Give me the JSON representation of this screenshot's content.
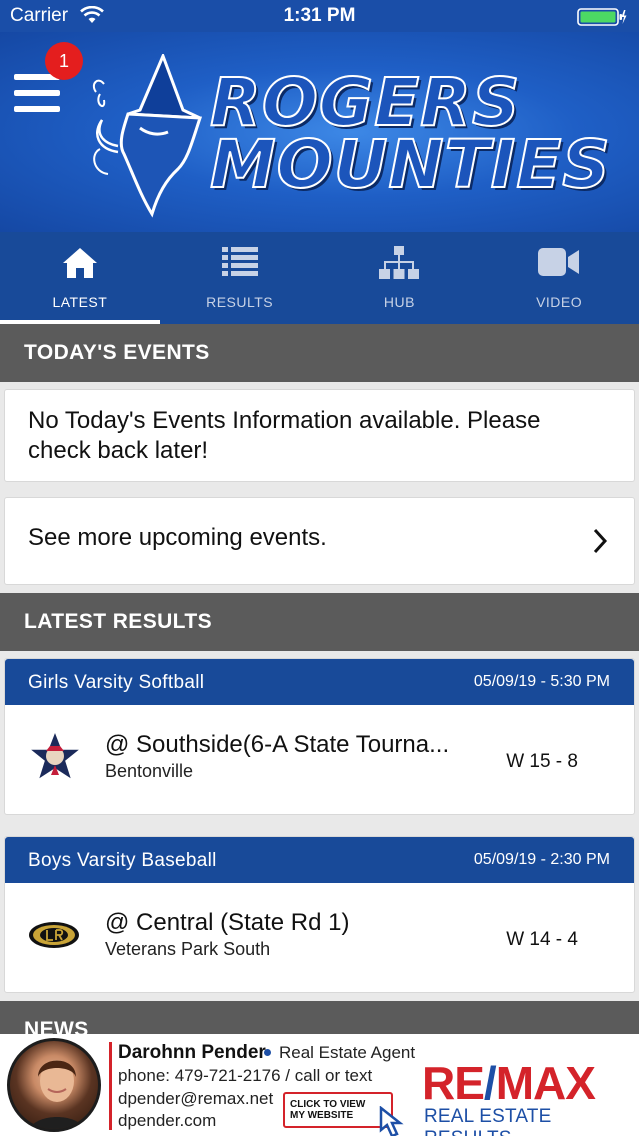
{
  "status_bar": {
    "carrier": "Carrier",
    "time": "1:31 PM"
  },
  "header": {
    "notification_count": "1",
    "team_name_line1": "ROGERS",
    "team_name_line2": "MOUNTIES"
  },
  "tabs": [
    {
      "label": "LATEST",
      "icon": "home-icon",
      "active": true
    },
    {
      "label": "RESULTS",
      "icon": "list-icon",
      "active": false
    },
    {
      "label": "HUB",
      "icon": "hub-icon",
      "active": false
    },
    {
      "label": "VIDEO",
      "icon": "video-camera-icon",
      "active": false
    }
  ],
  "todays_events": {
    "title": "TODAY'S EVENTS",
    "message": "No Today's Events Information available. Please check back later!",
    "more_link": "See more upcoming events."
  },
  "latest_results": {
    "title": "LATEST RESULTS",
    "items": [
      {
        "sport": "Girls Varsity Softball",
        "datetime": "05/09/19 - 5:30 PM",
        "opponent": "@ Southside(6-A State Tourna...",
        "venue": "Bentonville",
        "score": "W 15 - 8",
        "logo_icon": "southside-star-logo-icon"
      },
      {
        "sport": "Boys Varsity Baseball",
        "datetime": "05/09/19 - 2:30 PM",
        "opponent": "@ Central (State Rd 1)",
        "venue": "Veterans Park South",
        "score": "W 14 - 4",
        "logo_icon": "central-lr-logo-icon"
      }
    ]
  },
  "news": {
    "title": "NEWS"
  },
  "ad": {
    "name": "Darohnn Pender",
    "role": "Real Estate Agent",
    "phone": "phone: 479-721-2176 / call or text",
    "email": "dpender@remax.net",
    "website": "dpender.com",
    "cta_line1": "CLICK TO VIEW",
    "cta_line2": "MY WEBSITE",
    "brand_left": "RE",
    "brand_slash": "/",
    "brand_right": "MAX",
    "brand_sub": "REAL ESTATE RESULTS"
  },
  "colors": {
    "header_blue": "#1a4ea8",
    "tab_bar": "#184a99",
    "section_gray": "#5b5b5b",
    "badge_red": "#e41e1e",
    "remax_red": "#d4232a",
    "remax_blue": "#1d4fa6"
  }
}
